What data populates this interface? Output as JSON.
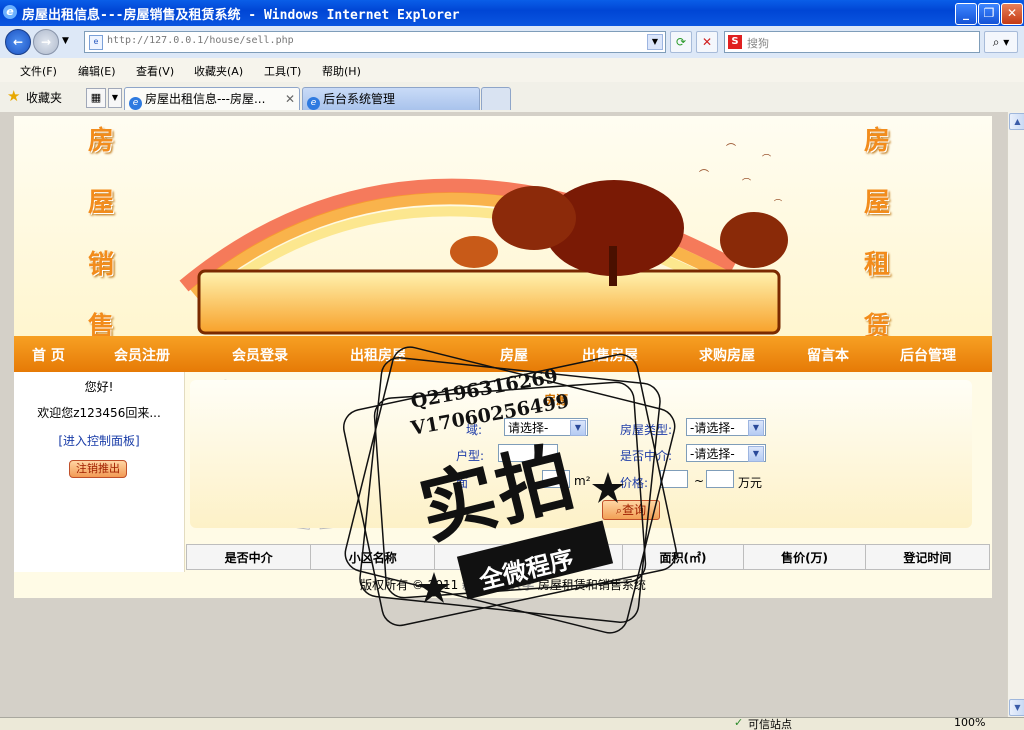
{
  "window": {
    "title": "房屋出租信息---房屋销售及租赁系统 - Windows Internet Explorer"
  },
  "address": {
    "url": "http://127.0.0.1/house/sell.php",
    "search_placeholder": "搜狗"
  },
  "menu": [
    "文件(F)",
    "编辑(E)",
    "查看(V)",
    "收藏夹(A)",
    "工具(T)",
    "帮助(H)"
  ],
  "favorites_label": "收藏夹",
  "tabs": [
    {
      "label": "房屋出租信息---房屋..."
    },
    {
      "label": "后台系统管理"
    }
  ],
  "banner": {
    "left_chars": [
      "房",
      "屋",
      "销",
      "售"
    ],
    "right_chars": [
      "房",
      "屋",
      "租",
      "赁"
    ]
  },
  "nav": [
    "首 页",
    "会员注册",
    "会员登录",
    "出租房屋",
    "房屋",
    "出售房屋",
    "求购房屋",
    "留言本",
    "后台管理"
  ],
  "user": {
    "greeting": "您好!",
    "welcome": "欢迎您z123456回来...",
    "control_panel": "[进入控制面板]",
    "logout": "注销推出"
  },
  "search": {
    "section_title": "房源",
    "area_label": "域:",
    "area_value": "请选择-",
    "type_label": "房屋类型:",
    "type_value": "-请选择-",
    "layout_label": "户型:",
    "agent_label": "是否中介:",
    "agent_value": "-请选择-",
    "area_size_label": "面",
    "area_unit": "m²",
    "price_label": "价格:",
    "price_sep": "~",
    "price_unit": "万元",
    "query": "查询"
  },
  "table_headers": [
    "是否中介",
    "小区名称",
    "所属区域",
    "房型",
    "面积(㎡)",
    "售价(万)",
    "登记时间"
  ],
  "footer": {
    "prefix": "版权所有 © 2011",
    "university": "新疆财经大学",
    "suffix": "房屋租赁和销售系统"
  },
  "watermark": {
    "qq": "Q2196316269",
    "wx": "V17060256499",
    "big": "实拍",
    "banner": "全微程序"
  },
  "status": {
    "zone": "可信站点",
    "zoom": "100%"
  },
  "colors": {
    "nav_orange": "#e67a06",
    "titlebar_blue": "#0046d5",
    "banner_char": "#f28c1c"
  }
}
